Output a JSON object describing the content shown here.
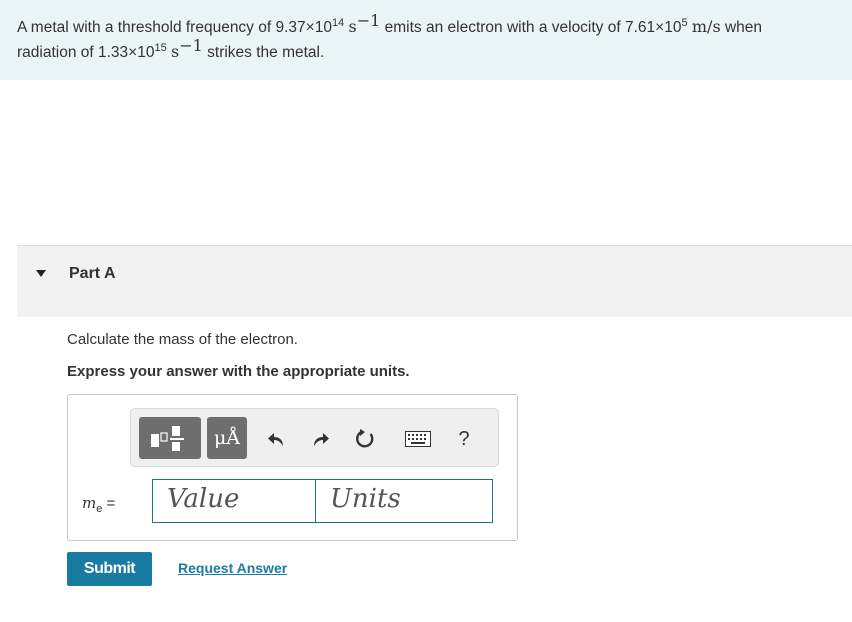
{
  "problem": {
    "line1_a": "A metal with a threshold frequency of 9.37×10",
    "line1_exp1": "14",
    "line1_unit1": "s",
    "line1_unit1_exp": "−1",
    "line1_b": " emits an electron with a velocity of 7.61×10",
    "line1_exp2": "5",
    "line1_unit2": "m/s",
    "line1_c": " when",
    "line2_a": "radiation of 1.33×10",
    "line2_exp": "15",
    "line2_unit": "s",
    "line2_unit_exp": "−1",
    "line2_b": " strikes the metal."
  },
  "part": {
    "title": "Part A"
  },
  "question": "Calculate the mass of the electron.",
  "instruction": "Express your answer with the appropriate units.",
  "toolbar": {
    "unit_button_label": "μÅ",
    "help_label": "?",
    "icons": [
      "templates-icon",
      "units-icon",
      "undo-icon",
      "redo-icon",
      "reset-icon",
      "keyboard-icon",
      "help-icon"
    ]
  },
  "answer": {
    "variable": "m",
    "subscript": "e",
    "equals": "=",
    "value_placeholder": "Value",
    "units_placeholder": "Units"
  },
  "buttons": {
    "submit": "Submit",
    "request": "Request Answer"
  },
  "colors": {
    "problem_bg": "#e9f5f7",
    "accent": "#1a7ba1",
    "input_border": "#1b708a",
    "toolbar_btn": "#6e6e6e"
  }
}
